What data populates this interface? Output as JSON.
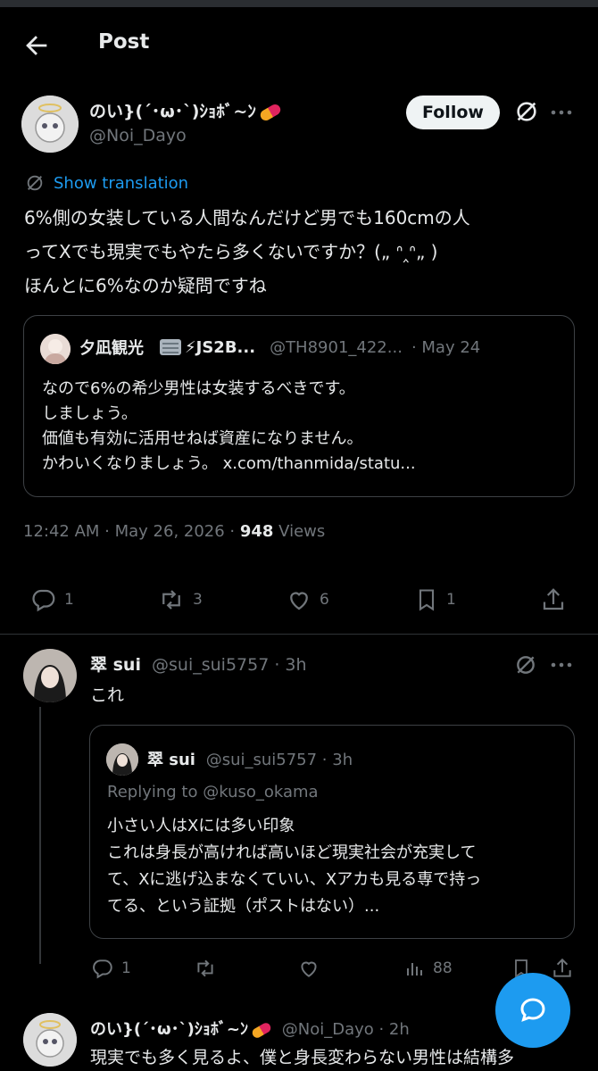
{
  "header": {
    "title": "Post"
  },
  "main_post": {
    "display_name": "のい}(´･ω･`)ｼｮﾎﾞ~ﾝ",
    "handle": "@Noi_Dayo",
    "follow_label": "Follow",
    "show_translation": "Show translation",
    "text_lines": [
      "6%側の女装している人間なんだけど男でも160cmの人",
      "ってXでも現実でもやたら多くないですか？(„ ᐢ‸ᐢ„ )",
      "ほんとに6%なのか疑問ですね"
    ],
    "quote": {
      "display_name": "夕凪観光",
      "name_suffix": "⚡JS2B...",
      "handle": "@TH8901_422...",
      "date": "· May 24",
      "lines": [
        "なので6%の希少男性は女装するべきです。",
        "しましょう。",
        "価値も有効に活用せねば資産になりません。",
        "かわいくなりましょう。 x.com/thanmida/statu..."
      ]
    },
    "timestamp": "12:42 AM · May 26, 2026 · ",
    "views_count": "948",
    "views_label": " Views",
    "stats": {
      "replies": "1",
      "reposts": "3",
      "likes": "6",
      "bookmarks": "1"
    }
  },
  "reply1": {
    "display_name": "翠 sui",
    "handle_time": "@sui_sui5757 · 3h",
    "text": "これ",
    "quote": {
      "display_name": "翠 sui",
      "handle_time": "@sui_sui5757 · 3h",
      "replying_prefix": "Replying to ",
      "replying_handle": "@kuso_okama",
      "lines": [
        "小さい人はXには多い印象",
        "これは身長が高ければ高いほど現実社会が充実して",
        "て、Xに逃げ込まなくていい、Xアカも見る専で持っ",
        "てる、という証拠（ポストはない）..."
      ]
    },
    "stats": {
      "replies": "1",
      "views": "88"
    }
  },
  "reply2": {
    "display_name": "のい}(´･ω･`)ｼｮﾎﾞ~ﾝ",
    "handle_time": "@Noi_Dayo · 2h",
    "text": "現実でも多く見るよ、僕と身長変わらない男性は結構多"
  },
  "colors": {
    "background": "#000000",
    "accent": "#1d9bf0",
    "muted": "#71767b",
    "pill": "#eff3f4"
  },
  "icons": [
    "back-arrow-icon",
    "grok-icon",
    "more-icon",
    "translate-icon",
    "reply-icon",
    "repost-icon",
    "like-icon",
    "bookmark-icon",
    "share-icon",
    "views-icon",
    "compose-icon",
    "pill-emoji-icon",
    "abacus-emoji-icon"
  ]
}
